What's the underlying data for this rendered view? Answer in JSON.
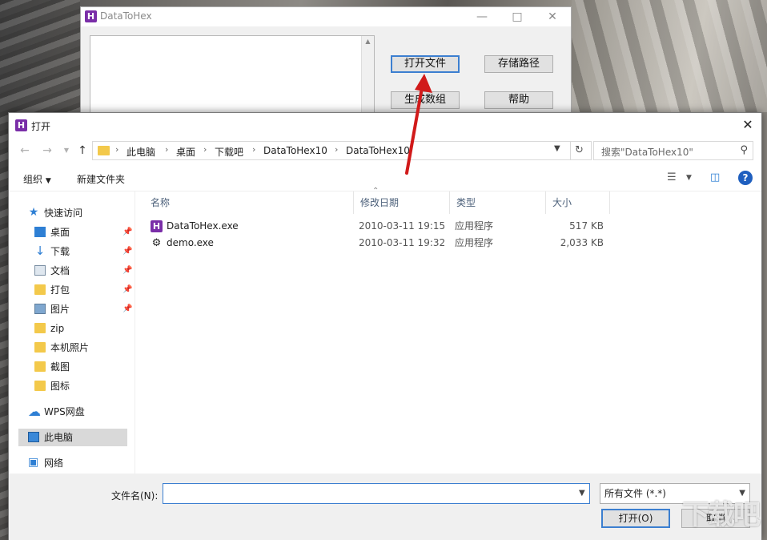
{
  "app": {
    "title": "DataToHex",
    "logo_letter": "H",
    "buttons": {
      "open_file": "打开文件",
      "save_path": "存储路径",
      "generate_array": "生成数组",
      "help": "帮助"
    }
  },
  "dialog": {
    "title": "打开",
    "breadcrumb": [
      "此电脑",
      "桌面",
      "下载吧",
      "DataToHex10",
      "DataToHex10"
    ],
    "search_placeholder": "搜索\"DataToHex10\"",
    "toolbar": {
      "organize": "组织",
      "new_folder": "新建文件夹"
    },
    "sidebar": [
      {
        "label": "快速访问",
        "icon": "star-icon"
      },
      {
        "label": "桌面",
        "icon": "desktop-icon",
        "pinned": true
      },
      {
        "label": "下载",
        "icon": "download-icon",
        "pinned": true
      },
      {
        "label": "文档",
        "icon": "document-icon",
        "pinned": true
      },
      {
        "label": "打包",
        "icon": "folder-icon",
        "pinned": true
      },
      {
        "label": "图片",
        "icon": "picture-icon",
        "pinned": true
      },
      {
        "label": "zip",
        "icon": "folder-icon"
      },
      {
        "label": "本机照片",
        "icon": "folder-icon"
      },
      {
        "label": "截图",
        "icon": "folder-icon"
      },
      {
        "label": "图标",
        "icon": "folder-icon"
      },
      {
        "label": "WPS网盘",
        "icon": "cloud-icon"
      },
      {
        "label": "此电脑",
        "icon": "computer-icon",
        "selected": true
      },
      {
        "label": "网络",
        "icon": "network-icon"
      }
    ],
    "columns": {
      "name": "名称",
      "modified": "修改日期",
      "type": "类型",
      "size": "大小"
    },
    "files": [
      {
        "name": "DataToHex.exe",
        "modified": "2010-03-11 19:15",
        "type": "应用程序",
        "size": "517 KB"
      },
      {
        "name": "demo.exe",
        "modified": "2010-03-11 19:32",
        "type": "应用程序",
        "size": "2,033 KB"
      }
    ],
    "filename_label": "文件名(N):",
    "filename_value": "",
    "filetype": "所有文件 (*.*)",
    "open_button": "打开(O)",
    "cancel_button": "取消"
  },
  "colors": {
    "accent": "#3c7fd0",
    "app_logo": "#7a2ea8",
    "arrow": "#d11a1a"
  }
}
